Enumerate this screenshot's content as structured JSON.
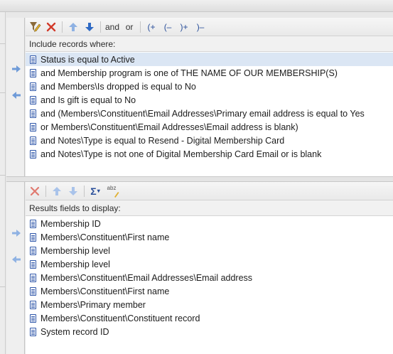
{
  "criteria": {
    "toolbar": {
      "and_label": "and",
      "or_label": "or",
      "and_open_paren_label": "(+",
      "or_open_paren_label": "(–",
      "and_close_paren_label": ")+",
      "or_close_paren_label": ")–"
    },
    "header": "Include records where:",
    "rows": [
      "Status is equal to Active",
      "and Membership program is one of THE NAME OF OUR MEMBERSHIP(S)",
      "and Members\\Is dropped is equal to No",
      "and Is gift is equal to No",
      "and (Members\\Constituent\\Email Addresses\\Primary email address is equal to Yes",
      "or Members\\Constituent\\Email Addresses\\Email address is blank)",
      "and Notes\\Type is equal to Resend - Digital Membership Card",
      "and Notes\\Type is not one of Digital Membership Card Email or is blank"
    ]
  },
  "results": {
    "toolbar": {
      "sigma_label": "Σ",
      "abz_label": "abz"
    },
    "header": "Results fields to display:",
    "rows": [
      "Membership ID",
      "Members\\Constituent\\First name",
      "Membership level",
      "Membership level",
      "Members\\Constituent\\Email Addresses\\Email address",
      "Members\\Constituent\\First name",
      "Members\\Primary member",
      "Members\\Constituent\\Constituent record",
      "System record ID"
    ]
  },
  "colors": {
    "arrow_blue": "#6f9bd8",
    "delete_red": "#d23a2a",
    "icon_blue": "#2d55a8",
    "selected_row": "#dbe6f4"
  }
}
